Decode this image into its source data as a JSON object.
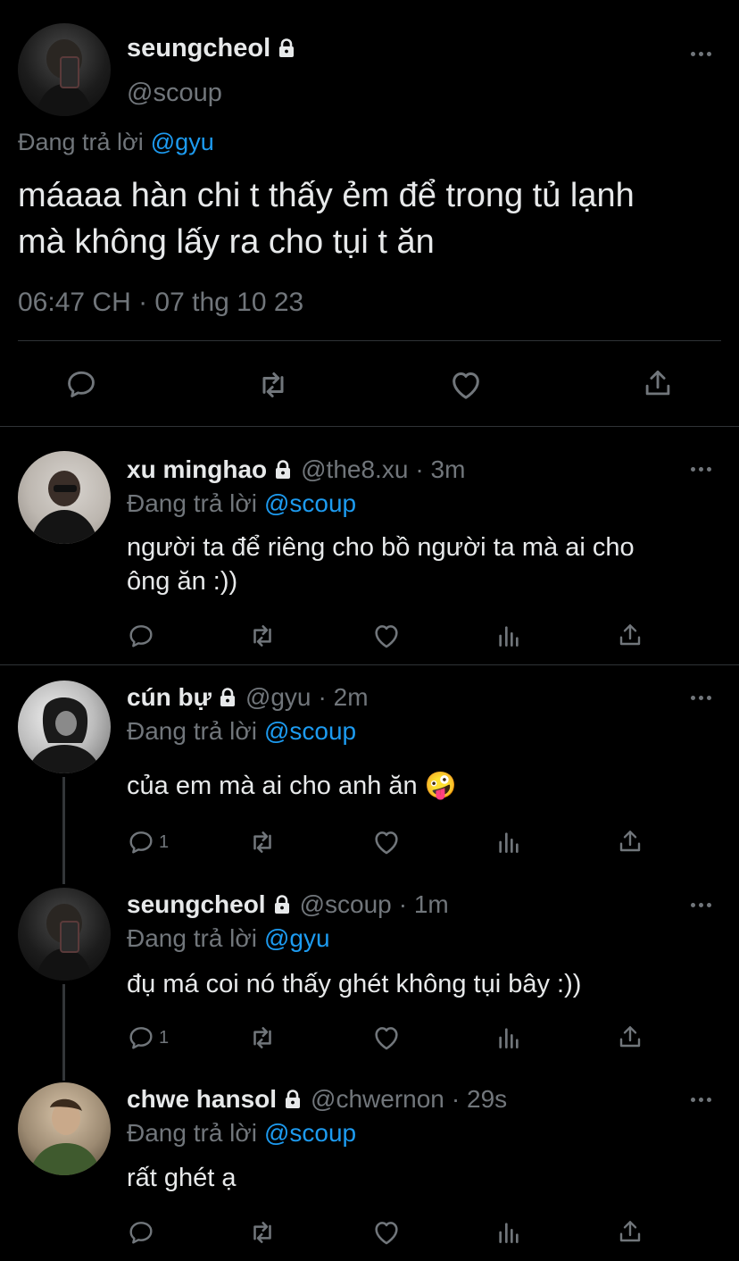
{
  "main_tweet": {
    "name": "seungcheol",
    "handle": "@scoup",
    "replying_prefix": "Đang trả lời",
    "replying_to": "@gyu",
    "text_line1": "máaaa hàn chi t thấy ẻm để trong tủ lạnh",
    "text_line2": "mà không lấy ra cho tụi t ăn",
    "timestamp": "06:47 CH · 07 thg 10 23"
  },
  "replies": [
    {
      "name": "xu minghao",
      "handle": "@the8.xu",
      "time": "· 3m",
      "replying_prefix": "Đang trả lời",
      "replying_to": "@scoup",
      "text_line1": "người ta để riêng cho bồ người ta mà ai cho",
      "text_line2": "ông ăn :))",
      "reply_count": ""
    },
    {
      "name": "cún bự",
      "handle": "@gyu",
      "time": "· 2m",
      "replying_prefix": "Đang trả lời",
      "replying_to": "@scoup",
      "text_line1": "của em mà ai cho anh ăn 🤪",
      "reply_count": "1"
    },
    {
      "name": "seungcheol",
      "handle": "@scoup",
      "time": "· 1m",
      "replying_prefix": "Đang trả lời",
      "replying_to": "@gyu",
      "text_line1": "đụ má coi nó thấy ghét không tụi bây :))",
      "reply_count": "1"
    },
    {
      "name": "chwe hansol",
      "handle": "@chwernon",
      "time": "· 29s",
      "replying_prefix": "Đang trả lời",
      "replying_to": "@scoup",
      "text_line1": "rất ghét ạ",
      "reply_count": ""
    }
  ],
  "icons": {
    "reply": "reply-icon",
    "retweet": "retweet-icon",
    "like": "heart-icon",
    "views": "analytics-icon",
    "share": "share-icon",
    "lock": "lock-icon",
    "more": "more-icon"
  },
  "colors": {
    "background": "#000000",
    "text": "#e7e9ea",
    "muted": "#71767b",
    "link": "#1d9bf0"
  }
}
